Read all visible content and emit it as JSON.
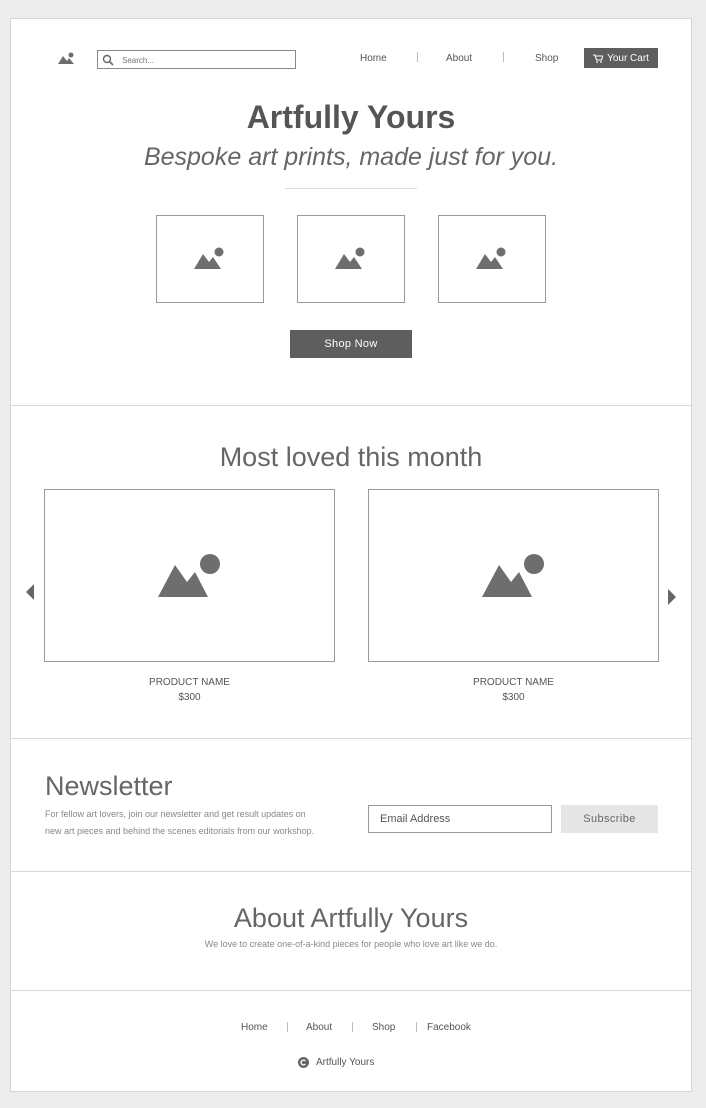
{
  "header": {
    "search_placeholder": "Search...",
    "nav": [
      "Home",
      "About",
      "Shop"
    ],
    "cart_label": "Your Cart"
  },
  "hero": {
    "title": "Artfully Yours",
    "subtitle": "Bespoke art prints, made just for you.",
    "cta_label": "Shop Now"
  },
  "featured": {
    "heading": "Most loved this month",
    "products": [
      {
        "name": "PRODUCT NAME",
        "price": "$300"
      },
      {
        "name": "PRODUCT NAME",
        "price": "$300"
      }
    ]
  },
  "newsletter": {
    "heading": "Newsletter",
    "body_line1": "For fellow art lovers, join our newsletter and get result updates on",
    "body_line2": "new art pieces and behind the scenes editorials from our workshop.",
    "email_placeholder": "Email Address",
    "subscribe_label": "Subscribe"
  },
  "about": {
    "heading": "About Artfully Yours",
    "body": "We love to create one-of-a-kind pieces for people who love art like we do."
  },
  "footer": {
    "links": [
      "Home",
      "About",
      "Shop",
      "Facebook"
    ],
    "copyright": "Artfully Yours"
  },
  "icons": {
    "logo": "image-icon",
    "search": "search-icon",
    "cart": "cart-icon",
    "placeholder": "image-placeholder-icon",
    "prev": "arrow-left-icon",
    "next": "arrow-right-icon",
    "copyright": "copyright-icon"
  },
  "colors": {
    "background": "#ececec",
    "panel": "#ffffff",
    "dark_button": "#5e5e5e",
    "light_button": "#e6e6e6",
    "icon_gray": "#6e6e6e"
  }
}
